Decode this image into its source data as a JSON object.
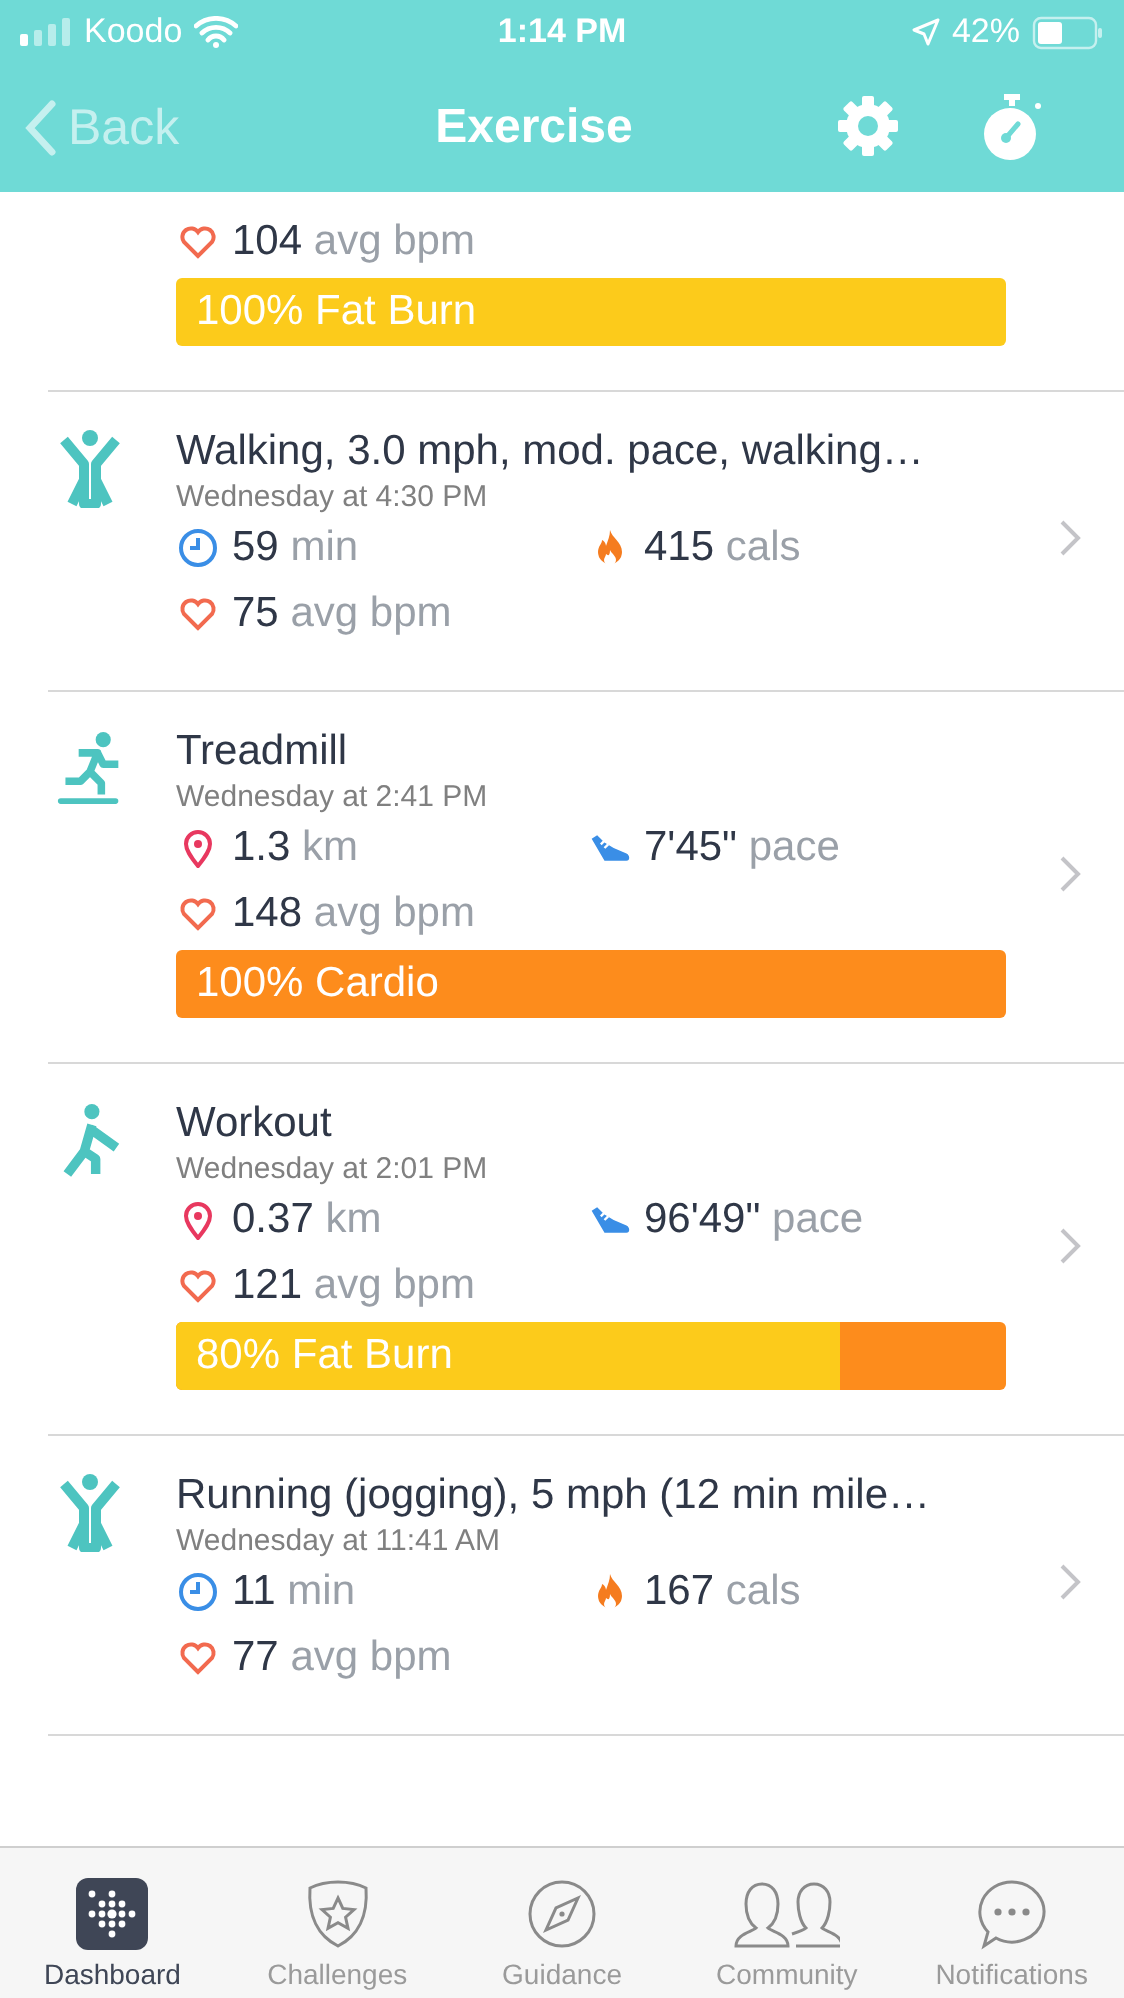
{
  "status_bar": {
    "carrier": "Koodo",
    "time": "1:14 PM",
    "battery": "42%"
  },
  "nav": {
    "back": "Back",
    "title": "Exercise"
  },
  "partial_entry": {
    "heart": {
      "value": "104",
      "unit": "avg bpm"
    },
    "zone_bar": {
      "label": "100% Fat Burn",
      "color": "#fccb1b"
    }
  },
  "entries": [
    {
      "kind": "walk",
      "title": "Walking, 3.0 mph, mod. pace, walking…",
      "date": "Wednesday at 4:30 PM",
      "stats": [
        {
          "kind": "time",
          "value": "59",
          "unit": "min"
        },
        {
          "kind": "calories",
          "value": "415",
          "unit": "cals"
        }
      ],
      "heart": {
        "value": "75",
        "unit": "avg bpm"
      }
    },
    {
      "kind": "treadmill",
      "title": "Treadmill",
      "date": "Wednesday at 2:41 PM",
      "stats": [
        {
          "kind": "distance",
          "value": "1.3",
          "unit": "km"
        },
        {
          "kind": "pace",
          "value": "7'45\"",
          "unit": "pace"
        }
      ],
      "heart": {
        "value": "148",
        "unit": "avg bpm"
      },
      "zone_bar": {
        "label": "100% Cardio",
        "color": "#fd8c1c"
      }
    },
    {
      "kind": "workout",
      "title": "Workout",
      "date": "Wednesday at 2:01 PM",
      "stats": [
        {
          "kind": "distance",
          "value": "0.37",
          "unit": "km"
        },
        {
          "kind": "pace",
          "value": "96'49\"",
          "unit": "pace"
        }
      ],
      "heart": {
        "value": "121",
        "unit": "avg bpm"
      },
      "zone_bar": {
        "label": "80% Fat Burn",
        "color": "#fd8c1c",
        "fill": {
          "color": "#fccb1b",
          "level": 0.8
        }
      }
    },
    {
      "kind": "walk",
      "title": "Running (jogging), 5 mph (12 min mile…",
      "date": "Wednesday at 11:41 AM",
      "stats": [
        {
          "kind": "time",
          "value": "11",
          "unit": "min"
        },
        {
          "kind": "calories",
          "value": "167",
          "unit": "cals"
        }
      ],
      "heart": {
        "value": "77",
        "unit": "avg bpm"
      }
    }
  ],
  "tabs": [
    {
      "kind": "dashboard",
      "label": "Dashboard",
      "selected": true
    },
    {
      "kind": "challenges",
      "label": "Challenges",
      "selected": false
    },
    {
      "kind": "guidance",
      "label": "Guidance",
      "selected": false
    },
    {
      "kind": "community",
      "label": "Community",
      "selected": false
    },
    {
      "kind": "notifications",
      "label": "Notifications",
      "selected": false
    }
  ]
}
